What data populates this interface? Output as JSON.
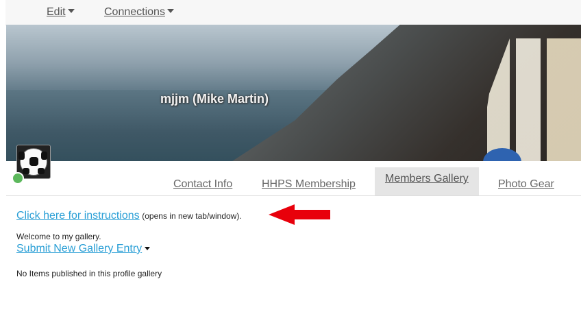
{
  "nav": {
    "edit_label": "Edit",
    "connections_label": "Connections"
  },
  "profile": {
    "name": "mjjm (Mike Martin)",
    "status_color": "#5cb85c"
  },
  "tabs": [
    {
      "label": "Contact Info",
      "active": false
    },
    {
      "label": "HHPS Membership",
      "active": false
    },
    {
      "label": "Members Gallery",
      "active": true
    },
    {
      "label": "Photo Gear",
      "active": false
    }
  ],
  "content": {
    "instructions_link": "Click here for instructions",
    "instructions_note": "(opens in new tab/window).",
    "welcome": "Welcome to my gallery.",
    "submit_link": "Submit New Gallery Entry",
    "empty_message": "No Items published in this profile gallery"
  },
  "colors": {
    "link": "#2a9fd6",
    "arrow": "#e8000b",
    "active_tab_bg": "#e5e5e5"
  }
}
